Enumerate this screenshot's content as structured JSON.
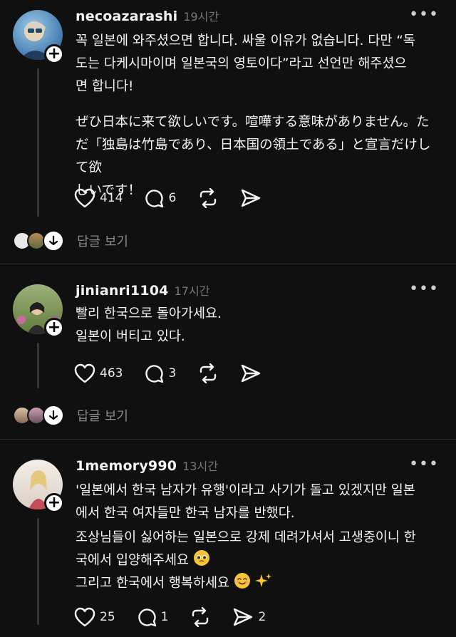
{
  "posts": [
    {
      "username": "necoazarashi",
      "time": "19시간",
      "lines": [
        "꼭 일본에 와주셨으면 합니다. 싸울 이유가 없습니다. 다만 “독",
        "도는 다케시마이며 일본국의 영토이다”라고 선언만 해주셨으",
        "면 합니다!"
      ],
      "lines2": [
        "ぜひ日本に来て欲しいです。喧嘩する意味がありません。た",
        "だ「独島は竹島であり、日本国の領土である」と宣言だけして欲",
        "しいです！"
      ],
      "likes": "414",
      "comments": "6",
      "reply_label": "답글 보기"
    },
    {
      "username": "jinianri1104",
      "time": "17시간",
      "lines": [
        "빨리 한국으로 돌아가세요.",
        "일본이 버티고 있다."
      ],
      "likes": "463",
      "comments": "3",
      "reply_label": "답글 보기"
    },
    {
      "username": "1memory990",
      "time": "13시간",
      "lines": [
        "'일본에서 한국 남자가 유행'이라고 사기가 돌고 있겠지만 일본",
        "에서 한국 여자들만 한국 남자를 반했다.",
        "조상님들이 싫어하는 일본으로 강제 데려가셔서 고생중이니 한",
        "국에서 입양해주세요",
        "그리고 한국에서 행복하세요"
      ],
      "likes": "25",
      "comments": "1",
      "shares": "2"
    }
  ],
  "icons": {
    "more": "more-horizontal-icon",
    "like": "heart-icon",
    "comment": "comment-icon",
    "repost": "repost-icon",
    "share": "send-icon",
    "follow": "plus-icon",
    "expand": "arrow-down-icon"
  },
  "colors": {
    "background": "#101010",
    "text": "#f3f5f7",
    "muted": "#777777"
  }
}
